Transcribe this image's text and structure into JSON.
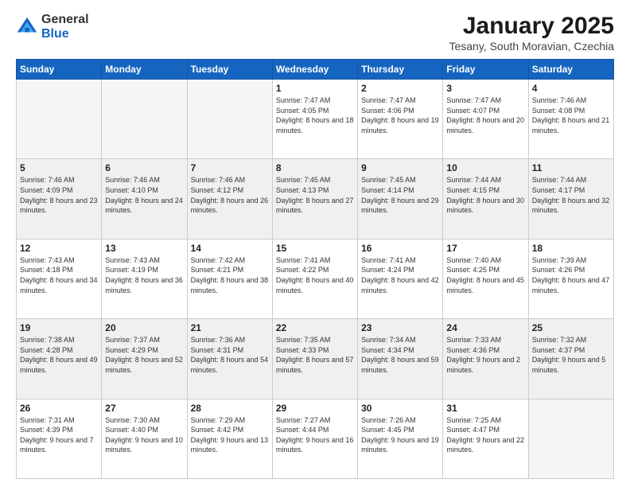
{
  "header": {
    "logo_general": "General",
    "logo_blue": "Blue",
    "month": "January 2025",
    "location": "Tesany, South Moravian, Czechia"
  },
  "days_of_week": [
    "Sunday",
    "Monday",
    "Tuesday",
    "Wednesday",
    "Thursday",
    "Friday",
    "Saturday"
  ],
  "weeks": [
    [
      {
        "day": "",
        "sunrise": "",
        "sunset": "",
        "daylight": ""
      },
      {
        "day": "",
        "sunrise": "",
        "sunset": "",
        "daylight": ""
      },
      {
        "day": "",
        "sunrise": "",
        "sunset": "",
        "daylight": ""
      },
      {
        "day": "1",
        "sunrise": "Sunrise: 7:47 AM",
        "sunset": "Sunset: 4:05 PM",
        "daylight": "Daylight: 8 hours and 18 minutes."
      },
      {
        "day": "2",
        "sunrise": "Sunrise: 7:47 AM",
        "sunset": "Sunset: 4:06 PM",
        "daylight": "Daylight: 8 hours and 19 minutes."
      },
      {
        "day": "3",
        "sunrise": "Sunrise: 7:47 AM",
        "sunset": "Sunset: 4:07 PM",
        "daylight": "Daylight: 8 hours and 20 minutes."
      },
      {
        "day": "4",
        "sunrise": "Sunrise: 7:46 AM",
        "sunset": "Sunset: 4:08 PM",
        "daylight": "Daylight: 8 hours and 21 minutes."
      }
    ],
    [
      {
        "day": "5",
        "sunrise": "Sunrise: 7:46 AM",
        "sunset": "Sunset: 4:09 PM",
        "daylight": "Daylight: 8 hours and 23 minutes."
      },
      {
        "day": "6",
        "sunrise": "Sunrise: 7:46 AM",
        "sunset": "Sunset: 4:10 PM",
        "daylight": "Daylight: 8 hours and 24 minutes."
      },
      {
        "day": "7",
        "sunrise": "Sunrise: 7:46 AM",
        "sunset": "Sunset: 4:12 PM",
        "daylight": "Daylight: 8 hours and 26 minutes."
      },
      {
        "day": "8",
        "sunrise": "Sunrise: 7:45 AM",
        "sunset": "Sunset: 4:13 PM",
        "daylight": "Daylight: 8 hours and 27 minutes."
      },
      {
        "day": "9",
        "sunrise": "Sunrise: 7:45 AM",
        "sunset": "Sunset: 4:14 PM",
        "daylight": "Daylight: 8 hours and 29 minutes."
      },
      {
        "day": "10",
        "sunrise": "Sunrise: 7:44 AM",
        "sunset": "Sunset: 4:15 PM",
        "daylight": "Daylight: 8 hours and 30 minutes."
      },
      {
        "day": "11",
        "sunrise": "Sunrise: 7:44 AM",
        "sunset": "Sunset: 4:17 PM",
        "daylight": "Daylight: 8 hours and 32 minutes."
      }
    ],
    [
      {
        "day": "12",
        "sunrise": "Sunrise: 7:43 AM",
        "sunset": "Sunset: 4:18 PM",
        "daylight": "Daylight: 8 hours and 34 minutes."
      },
      {
        "day": "13",
        "sunrise": "Sunrise: 7:43 AM",
        "sunset": "Sunset: 4:19 PM",
        "daylight": "Daylight: 8 hours and 36 minutes."
      },
      {
        "day": "14",
        "sunrise": "Sunrise: 7:42 AM",
        "sunset": "Sunset: 4:21 PM",
        "daylight": "Daylight: 8 hours and 38 minutes."
      },
      {
        "day": "15",
        "sunrise": "Sunrise: 7:41 AM",
        "sunset": "Sunset: 4:22 PM",
        "daylight": "Daylight: 8 hours and 40 minutes."
      },
      {
        "day": "16",
        "sunrise": "Sunrise: 7:41 AM",
        "sunset": "Sunset: 4:24 PM",
        "daylight": "Daylight: 8 hours and 42 minutes."
      },
      {
        "day": "17",
        "sunrise": "Sunrise: 7:40 AM",
        "sunset": "Sunset: 4:25 PM",
        "daylight": "Daylight: 8 hours and 45 minutes."
      },
      {
        "day": "18",
        "sunrise": "Sunrise: 7:39 AM",
        "sunset": "Sunset: 4:26 PM",
        "daylight": "Daylight: 8 hours and 47 minutes."
      }
    ],
    [
      {
        "day": "19",
        "sunrise": "Sunrise: 7:38 AM",
        "sunset": "Sunset: 4:28 PM",
        "daylight": "Daylight: 8 hours and 49 minutes."
      },
      {
        "day": "20",
        "sunrise": "Sunrise: 7:37 AM",
        "sunset": "Sunset: 4:29 PM",
        "daylight": "Daylight: 8 hours and 52 minutes."
      },
      {
        "day": "21",
        "sunrise": "Sunrise: 7:36 AM",
        "sunset": "Sunset: 4:31 PM",
        "daylight": "Daylight: 8 hours and 54 minutes."
      },
      {
        "day": "22",
        "sunrise": "Sunrise: 7:35 AM",
        "sunset": "Sunset: 4:33 PM",
        "daylight": "Daylight: 8 hours and 57 minutes."
      },
      {
        "day": "23",
        "sunrise": "Sunrise: 7:34 AM",
        "sunset": "Sunset: 4:34 PM",
        "daylight": "Daylight: 8 hours and 59 minutes."
      },
      {
        "day": "24",
        "sunrise": "Sunrise: 7:33 AM",
        "sunset": "Sunset: 4:36 PM",
        "daylight": "Daylight: 9 hours and 2 minutes."
      },
      {
        "day": "25",
        "sunrise": "Sunrise: 7:32 AM",
        "sunset": "Sunset: 4:37 PM",
        "daylight": "Daylight: 9 hours and 5 minutes."
      }
    ],
    [
      {
        "day": "26",
        "sunrise": "Sunrise: 7:31 AM",
        "sunset": "Sunset: 4:39 PM",
        "daylight": "Daylight: 9 hours and 7 minutes."
      },
      {
        "day": "27",
        "sunrise": "Sunrise: 7:30 AM",
        "sunset": "Sunset: 4:40 PM",
        "daylight": "Daylight: 9 hours and 10 minutes."
      },
      {
        "day": "28",
        "sunrise": "Sunrise: 7:29 AM",
        "sunset": "Sunset: 4:42 PM",
        "daylight": "Daylight: 9 hours and 13 minutes."
      },
      {
        "day": "29",
        "sunrise": "Sunrise: 7:27 AM",
        "sunset": "Sunset: 4:44 PM",
        "daylight": "Daylight: 9 hours and 16 minutes."
      },
      {
        "day": "30",
        "sunrise": "Sunrise: 7:26 AM",
        "sunset": "Sunset: 4:45 PM",
        "daylight": "Daylight: 9 hours and 19 minutes."
      },
      {
        "day": "31",
        "sunrise": "Sunrise: 7:25 AM",
        "sunset": "Sunset: 4:47 PM",
        "daylight": "Daylight: 9 hours and 22 minutes."
      },
      {
        "day": "",
        "sunrise": "",
        "sunset": "",
        "daylight": ""
      }
    ]
  ]
}
